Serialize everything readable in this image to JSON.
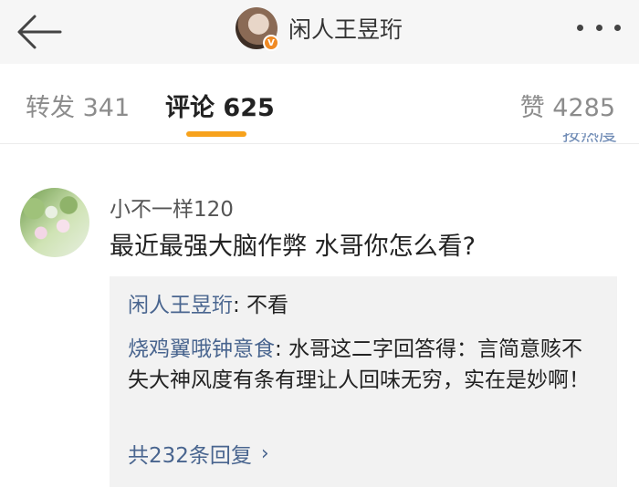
{
  "header": {
    "back_icon": "arrow-left-icon",
    "title": "闲人王昱珩",
    "verified_badge": "V",
    "more_icon": "more-dots-icon"
  },
  "tabs": [
    {
      "label": "转发",
      "count": "341",
      "active": false
    },
    {
      "label": "评论",
      "count": "625",
      "active": true
    },
    {
      "label": "赞",
      "count": "4285",
      "active": false
    }
  ],
  "sort_label": "按热度",
  "comment": {
    "username": "小不一样120",
    "text": "最近最强大脑作弊 水哥你怎么看?",
    "replies": [
      {
        "author": "闲人王昱珩",
        "text": ": 不看"
      },
      {
        "author": "烧鸡翼哦钟意食",
        "text": ": 水哥这二字回答得：言简意赅不失大神风度有条有理让人回味无穷，实在是妙啊！"
      }
    ],
    "more_replies": "共232条回复",
    "more_icon": "chevron-right-icon"
  },
  "colors": {
    "accent": "#f7a21c",
    "link": "#49658f",
    "reply_bg": "#f2f2f2",
    "verified": "#f08a24"
  }
}
